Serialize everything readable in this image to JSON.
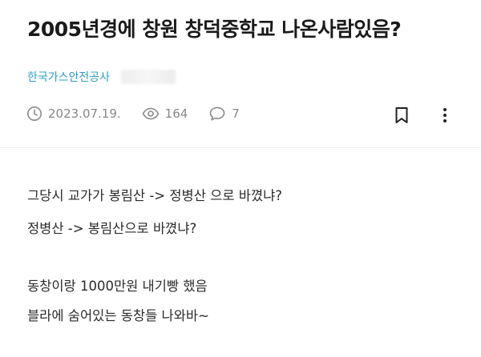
{
  "post": {
    "title": "2005년경에 창원 창덕중학교 나온사람있음?",
    "author": {
      "company": "한국가스안전공사"
    },
    "meta": {
      "date": "2023.07.19.",
      "views": "164",
      "comments": "7"
    },
    "body_lines": [
      "그당시 교가가 봉림산 -> 정병산 으로 바꼈냐?",
      "정병산 -> 봉림산으로 바꼈냐?",
      "동창이랑 1000만원 내기빵 했음",
      "블라에 숨어있는 동창들 나와바~"
    ]
  },
  "icons": {
    "date": "clock-icon",
    "views": "eye-icon",
    "comments": "speech-bubble-icon",
    "bookmark": "bookmark-icon",
    "more": "more-dots-icon"
  },
  "colors": {
    "company": "#2f9fc0",
    "meta": "#888888",
    "title": "#1a1a1a"
  }
}
